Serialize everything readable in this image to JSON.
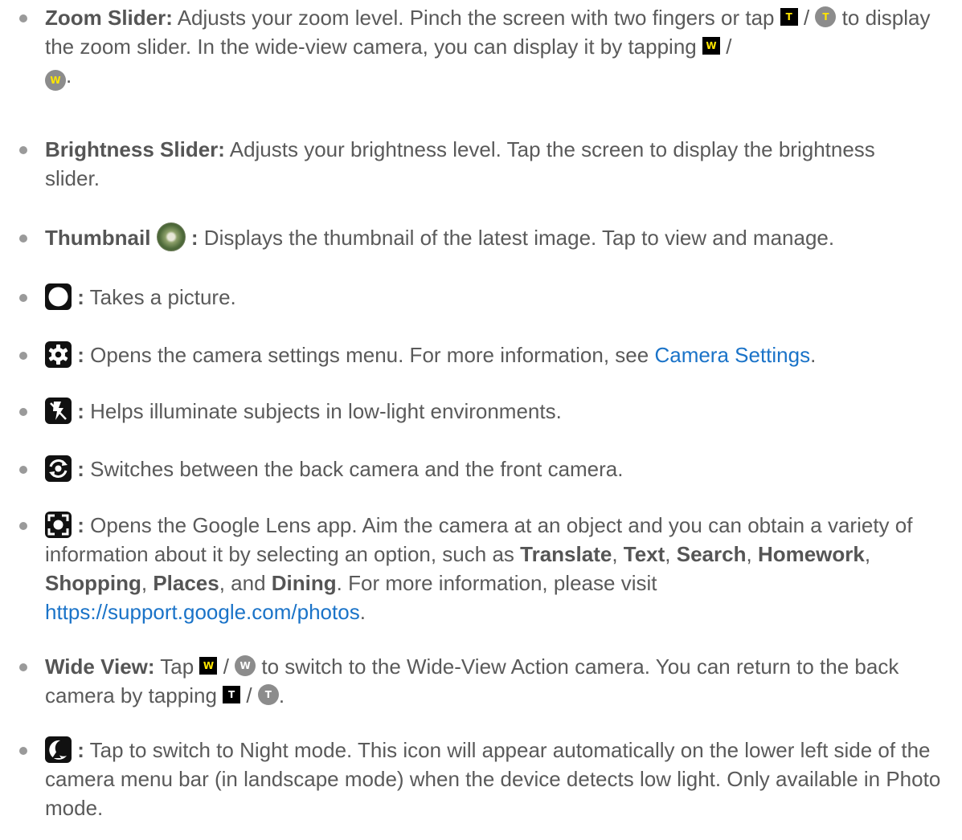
{
  "items": [
    {
      "heading": "Zoom Slider:",
      "text1": " Adjusts your zoom level. Pinch the screen with two fingers or tap ",
      "sep": "/",
      "text2": "to display the zoom slider. In the wide-view camera, you can display it by tapping ",
      "sep2": "/",
      "end": "."
    },
    {
      "heading": "Brightness Slider:",
      "text": " Adjusts your brightness level. Tap the screen to display the brightness slider."
    },
    {
      "heading": "Thumbnail",
      "colon": " :",
      "text": " Displays the thumbnail of the latest image. Tap to view and manage."
    },
    {
      "colon": ":",
      "text": " Takes a picture."
    },
    {
      "colon": ":",
      "text": " Opens the camera settings menu. For more information, see ",
      "link": "Camera Settings",
      "end": "."
    },
    {
      "colon": ":",
      "text": " Helps illuminate subjects in low-light environments."
    },
    {
      "colon": ":",
      "text": " Switches between the back camera and the front camera."
    },
    {
      "colon": ":",
      "text1": " Opens the Google Lens app. Aim the camera at an object and you can obtain a variety of information about it by selecting an option, such as ",
      "b1": "Translate",
      "c1": ", ",
      "b2": "Text",
      "c2": ", ",
      "b3": "Search",
      "c3": ", ",
      "b4": "Homework",
      "c4": ", ",
      "b5": "Shopping",
      "c5": ", ",
      "b6": "Places",
      "c6": ", and ",
      "b7": "Dining",
      "text2": ". For more information, please visit ",
      "link": "https://support.google.com/photos",
      "end": "."
    },
    {
      "heading": "Wide View:",
      "text1": " Tap ",
      "sep": "/",
      "text2": " to switch to the Wide-View Action camera. You can return to the back camera by tapping ",
      "sep2": "/",
      "end": "."
    },
    {
      "colon": ":",
      "text": " Tap to switch to Night mode. This icon will appear automatically on the lower left side of the camera menu bar (in landscape mode) when the device detects low light. Only available in Photo mode."
    }
  ],
  "icon_letters": {
    "tele": "T",
    "wide": "W"
  },
  "colors": {
    "link": "#1a73c8",
    "text": "#5a5a5a",
    "icon_letter": "#ffe600"
  }
}
